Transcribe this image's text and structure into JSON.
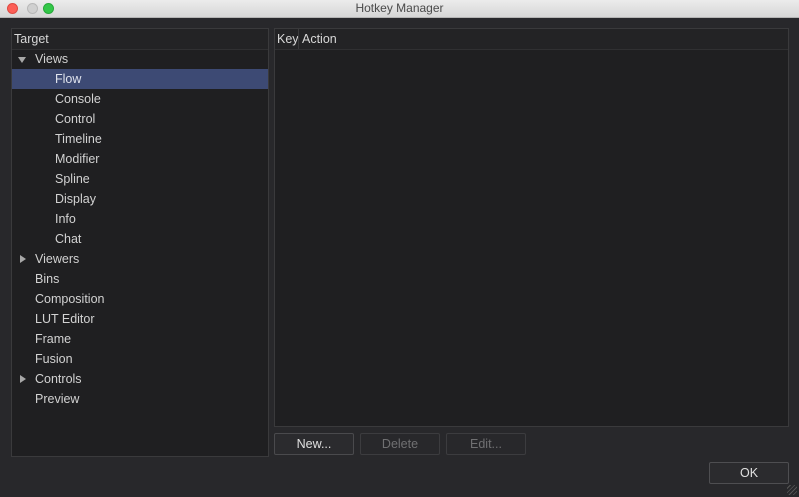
{
  "window": {
    "title": "Hotkey Manager"
  },
  "target_panel": {
    "header": "Target",
    "items": [
      {
        "label": "Views",
        "expanded": true,
        "expander": "expanded"
      },
      {
        "label": "Flow",
        "selected": true,
        "child": true
      },
      {
        "label": "Console",
        "child": true
      },
      {
        "label": "Control",
        "child": true
      },
      {
        "label": "Timeline",
        "child": true
      },
      {
        "label": "Modifier",
        "child": true
      },
      {
        "label": "Spline",
        "child": true
      },
      {
        "label": "Display",
        "child": true
      },
      {
        "label": "Info",
        "child": true
      },
      {
        "label": "Chat",
        "child": true
      },
      {
        "label": "Viewers",
        "expander": "collapsed"
      },
      {
        "label": "Bins"
      },
      {
        "label": "Composition"
      },
      {
        "label": "LUT Editor"
      },
      {
        "label": "Frame"
      },
      {
        "label": "Fusion"
      },
      {
        "label": "Controls",
        "expander": "collapsed"
      },
      {
        "label": "Preview"
      }
    ]
  },
  "hotkey_table": {
    "columns": {
      "key": "Key",
      "action": "Action"
    },
    "rows": []
  },
  "buttons": {
    "new": "New...",
    "delete": "Delete",
    "edit": "Edit...",
    "ok": "OK"
  },
  "colors": {
    "selection": "#3d4a74",
    "background": "#28282b",
    "panel": "#1f1f21"
  }
}
